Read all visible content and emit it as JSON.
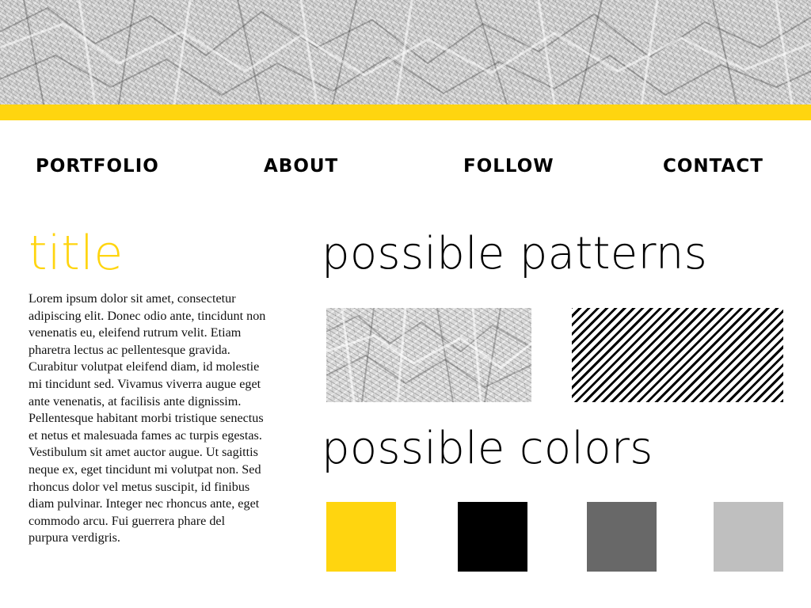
{
  "nav": {
    "items": [
      {
        "label": "PORTFOLIO"
      },
      {
        "label": "ABOUT"
      },
      {
        "label": "FOLLOW"
      },
      {
        "label": "CONTACT"
      }
    ]
  },
  "content": {
    "title": "title",
    "body": "Lorem ipsum dolor sit amet, consectetur adipiscing elit. Donec odio ante, tincidunt non venenatis eu, eleifend rutrum velit. Etiam pharetra lectus ac pellentesque gravida. Curabitur volutpat eleifend diam, id molestie mi tincidunt sed. Vivamus viverra augue eget ante venenatis, at facilisis ante dignissim. Pellentesque habitant morbi tristique senectus et netus et malesuada fames ac turpis egestas. Vestibulum sit amet auctor augue. Ut sagittis neque ex, eget tincidunt mi volutpat non. Sed rhoncus dolor vel metus suscipit, id finibus diam pulvinar. Integer nec rhoncus ante, eget commodo arcu. Fui guerrera phare del purpura verdigris."
  },
  "patterns": {
    "heading": "possible patterns",
    "items": [
      {
        "icon": "crumpled-paper-pattern"
      },
      {
        "icon": "diagonal-stripe-pattern"
      }
    ]
  },
  "colors": {
    "heading": "possible colors",
    "swatches": [
      "#FFD50F",
      "#000000",
      "#686868",
      "#BFBFBF"
    ]
  },
  "theme": {
    "accent": "#FFD50F"
  }
}
